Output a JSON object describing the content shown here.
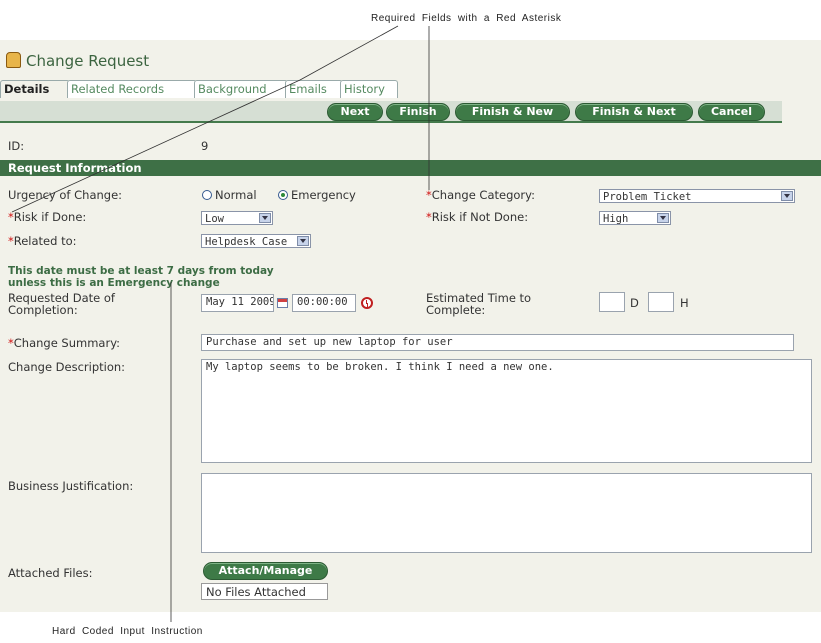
{
  "annotations": {
    "top": "Required Fields with a Red Asterisk",
    "bottom": "Hard Coded Input Instruction"
  },
  "header": {
    "title": "Change Request",
    "icon": "bear-icon"
  },
  "tabs": [
    "Details",
    "Related Records",
    "Background",
    "Emails",
    "History"
  ],
  "toolbar": [
    "Next",
    "Finish",
    "Finish & New",
    "Finish & Next",
    "Cancel"
  ],
  "id": {
    "label": "ID:",
    "value": "9"
  },
  "section": "Request Information",
  "required_marker": "*",
  "fields": {
    "urgency": {
      "label": "Urgency of Change:",
      "options": [
        "Normal",
        "Emergency"
      ],
      "selected": "Emergency"
    },
    "change_category": {
      "label": "Change Category:",
      "value": "Problem Ticket"
    },
    "risk_if_done": {
      "label": "Risk if Done:",
      "value": "Low"
    },
    "risk_if_not_done": {
      "label": "Risk if Not Done:",
      "value": "High"
    },
    "related_to": {
      "label": "Related to:",
      "value": "Helpdesk Case"
    },
    "date_note": "This date must be at least 7 days from today unless this is an Emergency change",
    "requested_date": {
      "label": "Requested Date of Completion:",
      "date": "May 11 2009",
      "time": "00:00:00"
    },
    "estimated_time": {
      "label": "Estimated Time to Complete:",
      "days_unit": "D",
      "hours_unit": "H",
      "days": "",
      "hours": ""
    },
    "change_summary": {
      "label": "Change Summary:",
      "value": "Purchase and set up new laptop for user"
    },
    "change_description": {
      "label": "Change Description:",
      "value": "My laptop seems to be broken. I think I need a new one."
    },
    "business_justification": {
      "label": "Business Justification:",
      "value": ""
    },
    "attached_files": {
      "label": "Attached Files:",
      "button": "Attach/Manage",
      "status": "No Files Attached"
    }
  },
  "colors": {
    "accent": "#3e7046",
    "required": "#d01010",
    "panel": "#f2f2ea"
  }
}
